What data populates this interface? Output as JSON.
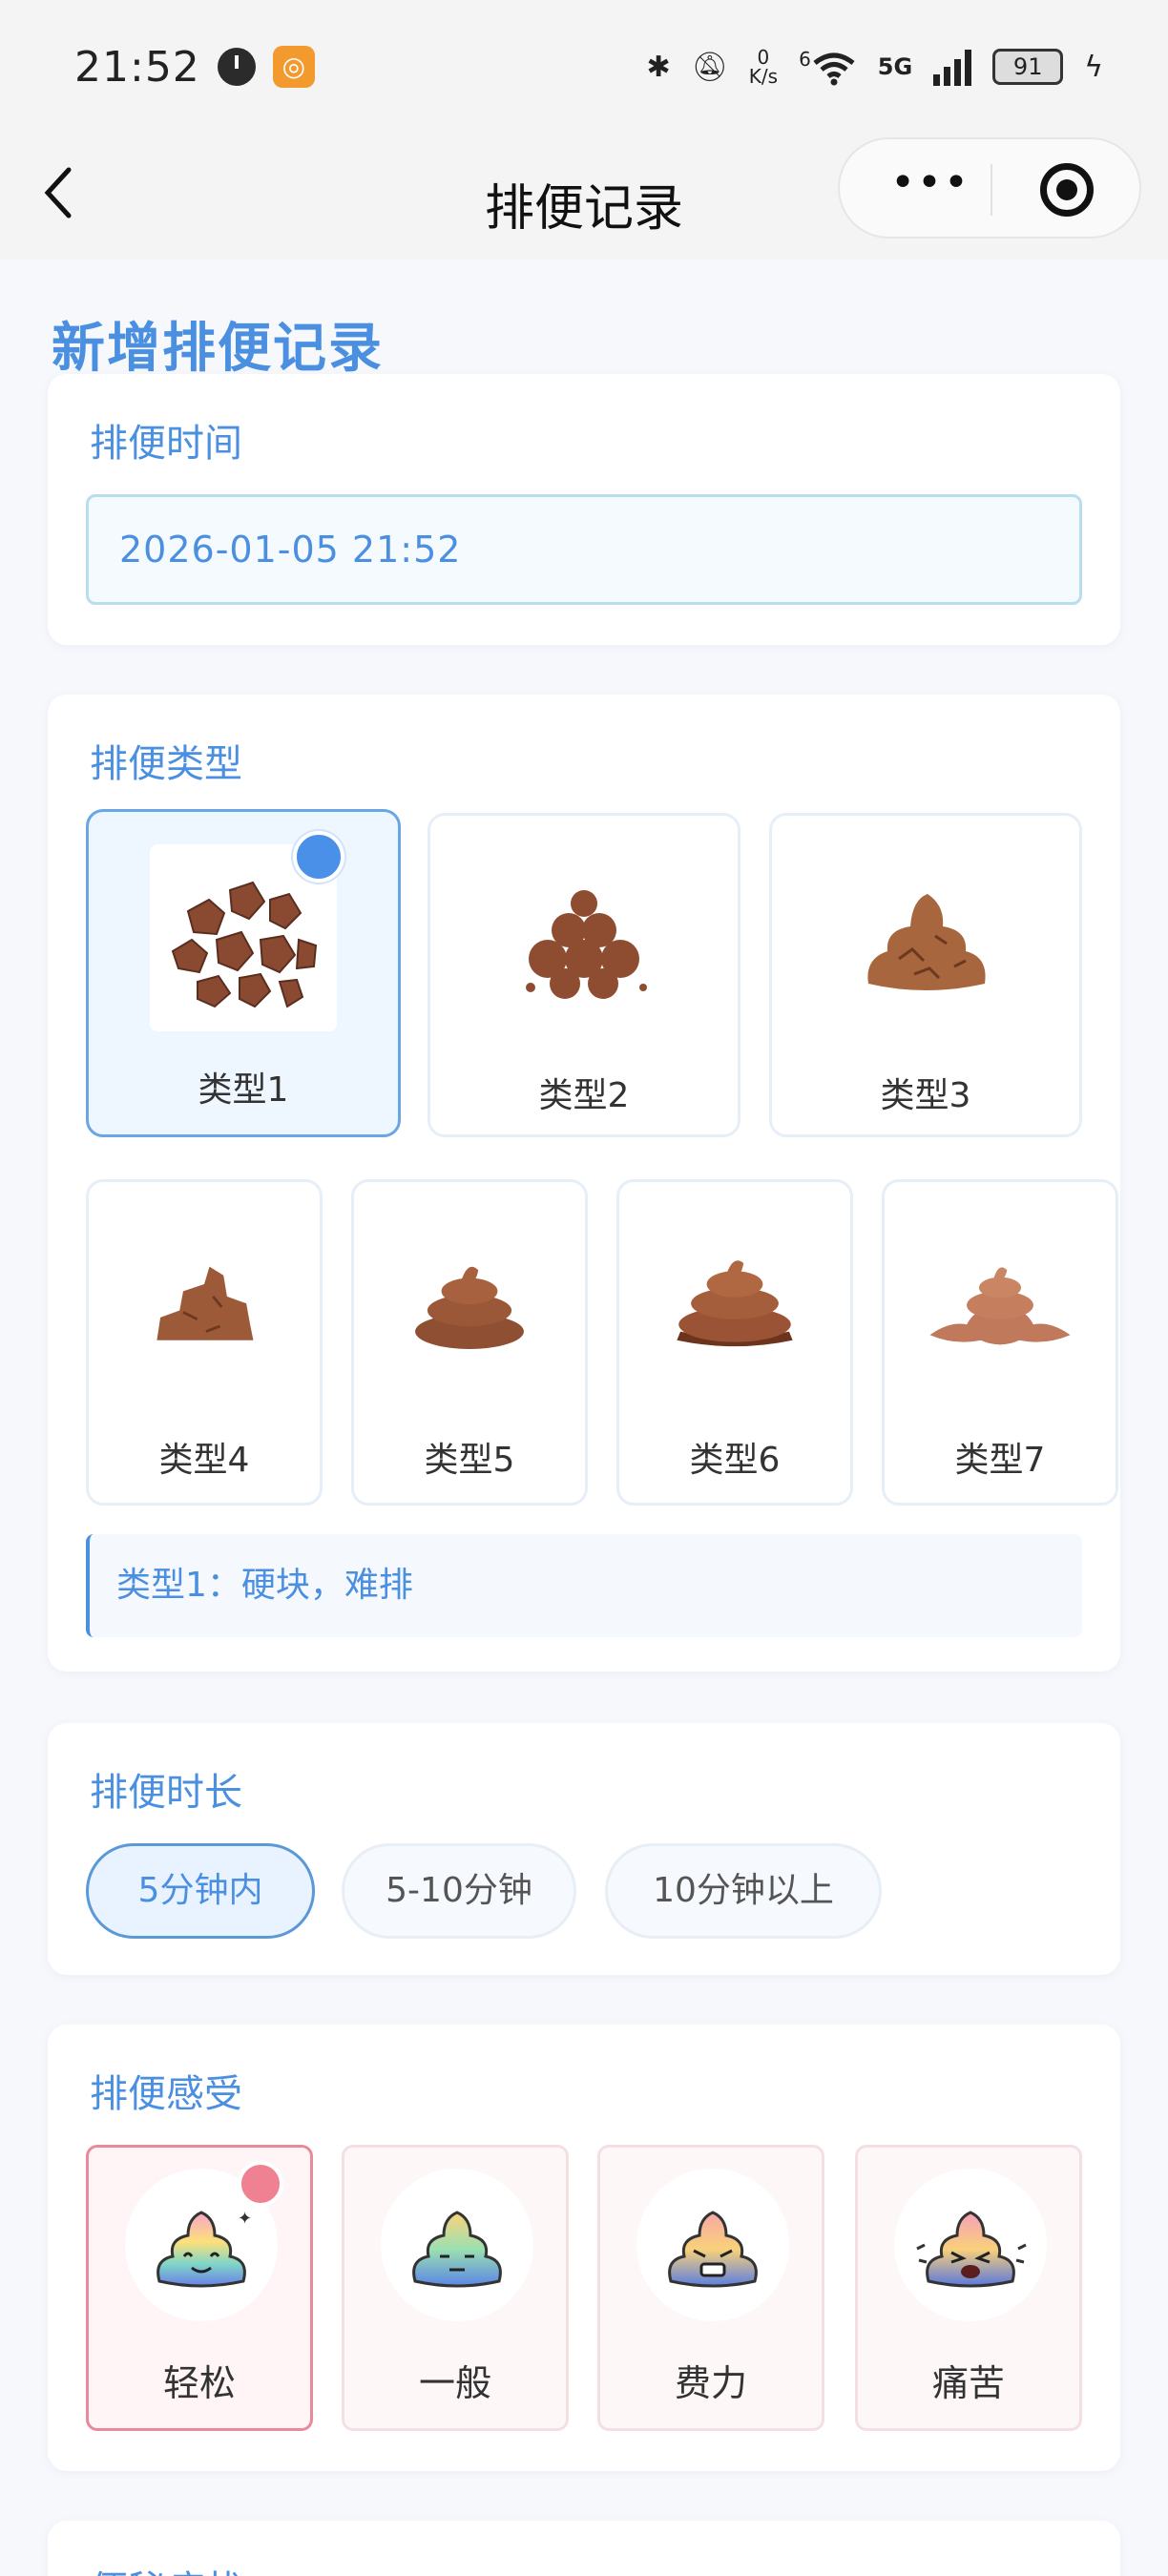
{
  "status_bar": {
    "time": "21:52",
    "net_speed_top": "0",
    "net_speed_unit": "K/s",
    "network": "5G",
    "wifi_mark": "6",
    "battery": "91"
  },
  "nav": {
    "title": "排便记录",
    "more_label": "•••"
  },
  "page": {
    "title": "新增排便记录"
  },
  "time_section": {
    "label": "排便时间",
    "value": "2026-01-05 21:52"
  },
  "type_section": {
    "label": "排便类型",
    "types": [
      {
        "label": "类型1",
        "icon": "hard-lumps-icon"
      },
      {
        "label": "类型2",
        "icon": "lumpy-sausage-icon"
      },
      {
        "label": "类型3",
        "icon": "cracked-sausage-icon"
      },
      {
        "label": "类型4",
        "icon": "soft-sausage-icon"
      },
      {
        "label": "类型5",
        "icon": "soft-blobs-icon"
      },
      {
        "label": "类型6",
        "icon": "mushy-icon"
      },
      {
        "label": "类型7",
        "icon": "liquid-icon"
      }
    ],
    "selected_index": 0,
    "description": "类型1：硬块，难排"
  },
  "duration_section": {
    "label": "排便时长",
    "options": [
      "5分钟内",
      "5-10分钟",
      "10分钟以上"
    ],
    "selected_index": 0
  },
  "feeling_section": {
    "label": "排便感受",
    "options": [
      {
        "label": "轻松",
        "icon": "happy-poop-icon"
      },
      {
        "label": "一般",
        "icon": "neutral-poop-icon"
      },
      {
        "label": "费力",
        "icon": "straining-poop-icon"
      },
      {
        "label": "痛苦",
        "icon": "pain-poop-icon"
      }
    ],
    "selected_index": 0
  },
  "next_section": {
    "label": "便秘症状"
  },
  "colors": {
    "accent_blue": "#4a8fe0",
    "accent_pink": "#ef8193",
    "poop_brown": "#9a5a3c"
  }
}
